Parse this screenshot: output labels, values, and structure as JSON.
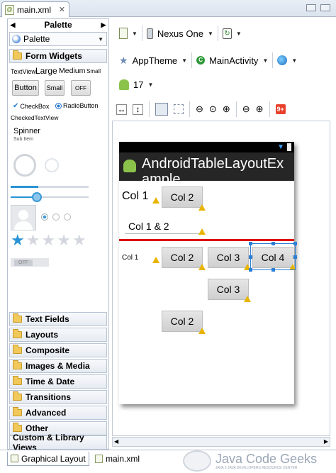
{
  "editor_tab": {
    "title": "main.xml"
  },
  "palette": {
    "header": "Palette",
    "dropdown": "Palette",
    "open_section": "Form Widgets",
    "widgets": {
      "textview": "TextView",
      "large": "Large",
      "medium": "Medium",
      "small": "Small",
      "button": "Button",
      "small_button": "Small",
      "off": "OFF",
      "checkbox": "CheckBox",
      "radiobutton": "RadioButton",
      "checked_textview": "CheckedTextView",
      "spinner": "Spinner",
      "sub_item": "Sub Item",
      "switch_off": "OFF"
    },
    "sections": [
      "Text Fields",
      "Layouts",
      "Composite",
      "Images & Media",
      "Time & Date",
      "Transitions",
      "Advanced",
      "Other"
    ],
    "custom": "Custom & Library Views"
  },
  "toolbar": {
    "device": "Nexus One",
    "theme": "AppTheme",
    "activity": "MainActivity",
    "api_level": "17",
    "warnings_badge": "9+"
  },
  "device_screen": {
    "app_title_line1": "AndroidTableLayoutEx",
    "app_title_line2": "ample",
    "row1": {
      "label": "Col 1",
      "button": "Col 2"
    },
    "row2": {
      "label": "Col 1 & 2"
    },
    "row3": {
      "label": "Col 1",
      "b1": "Col 2",
      "b2": "Col 3",
      "b3": "Col 4"
    },
    "row4": {
      "b1": "Col 3"
    },
    "row5": {
      "b1": "Col 2"
    }
  },
  "bottom_tabs": {
    "graphical": "Graphical Layout",
    "xml": "main.xml"
  },
  "watermark": {
    "brand": "Java Code Geeks",
    "sub": "JAVA 2 JAVA DEVELOPERS RESOURCE CENTER"
  },
  "colors": {
    "accent": "#2b7fd6",
    "warning": "#e8b400",
    "divider": "#dd1111",
    "badge": "#e8402b"
  }
}
